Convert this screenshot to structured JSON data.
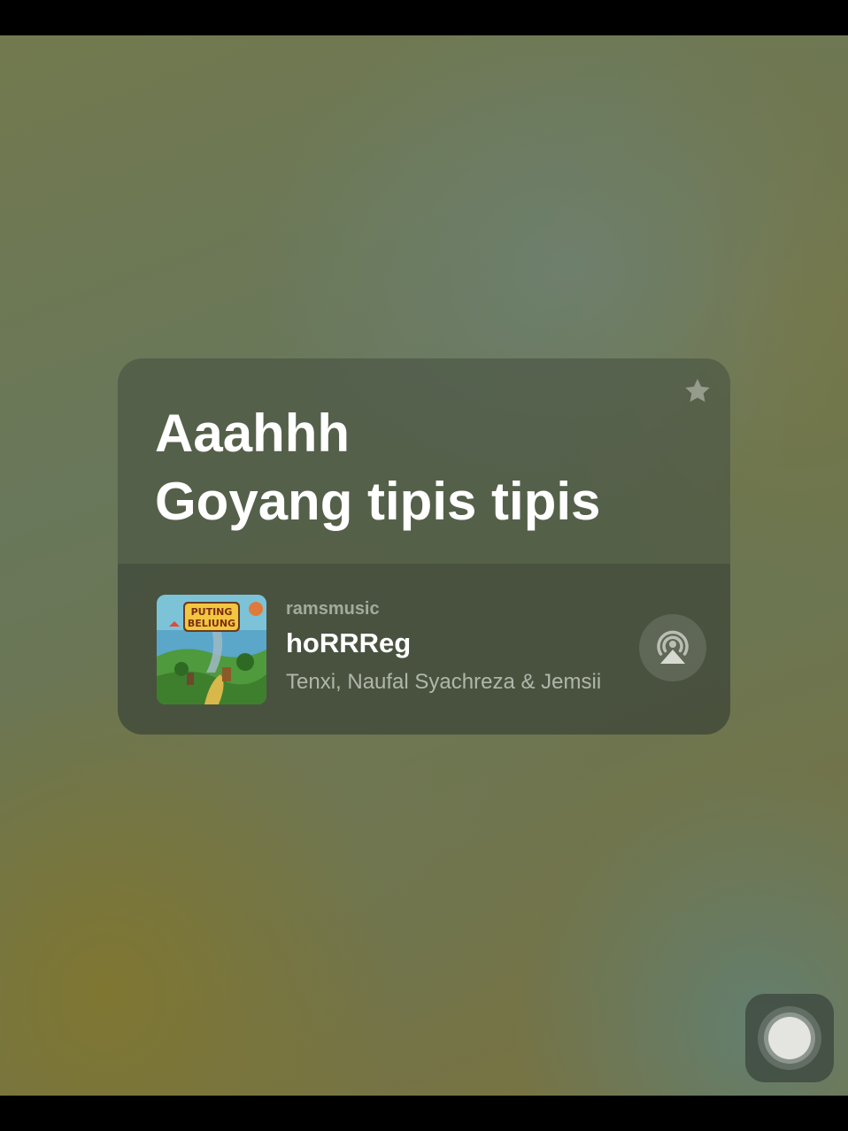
{
  "widget": {
    "lyrics": [
      "Aaahhh",
      "Goyang tipis tipis"
    ],
    "track": {
      "shared_by": "ramsmusic",
      "title": "hoRRReg",
      "artists": "Tenxi, Naufal Syachreza & Jemsii",
      "artwork_text": [
        "PUTING",
        "BELIUNG"
      ]
    },
    "icons": {
      "favorite": "star-icon",
      "output": "airplay-icon",
      "assistive_touch": "assistive-touch-icon"
    }
  },
  "colors": {
    "text_primary": "#ffffff",
    "text_secondary": "#c8cec0"
  }
}
